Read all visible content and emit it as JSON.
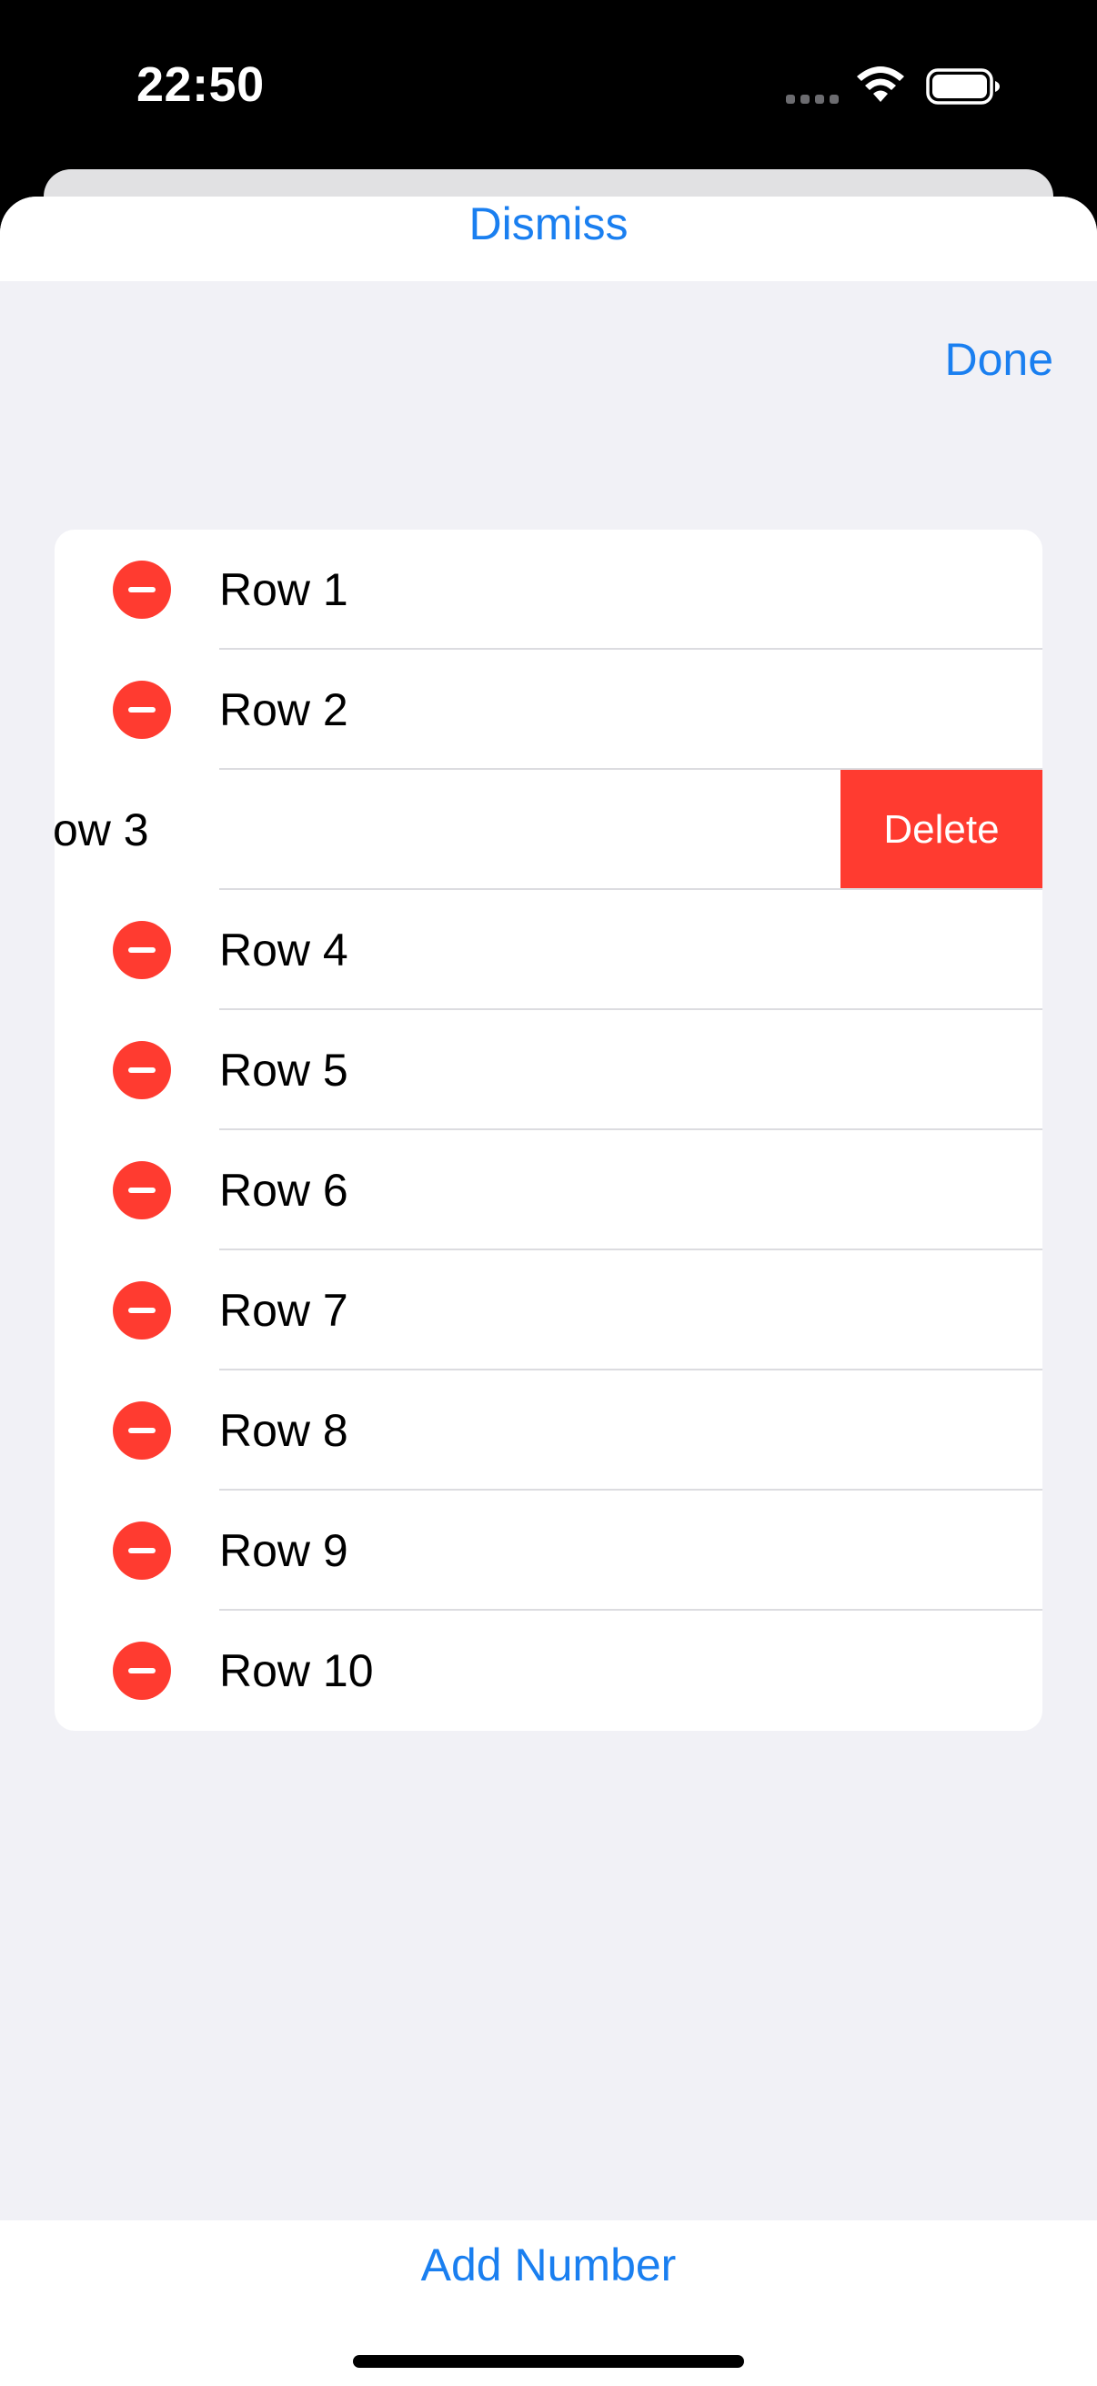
{
  "status_bar": {
    "time": "22:50",
    "icons": [
      "cellular-signal-icon",
      "wifi-icon",
      "battery-icon"
    ]
  },
  "sheet": {
    "dismiss_label": "Dismiss",
    "done_label": "Done"
  },
  "list": {
    "rows": [
      {
        "label": "Row 1"
      },
      {
        "label": "Row 2"
      },
      {
        "label": "ow 3",
        "swiped": true,
        "action_label": "Delete"
      },
      {
        "label": "Row 4"
      },
      {
        "label": "Row 5"
      },
      {
        "label": "Row 6"
      },
      {
        "label": "Row 7"
      },
      {
        "label": "Row 8"
      },
      {
        "label": "Row 9"
      },
      {
        "label": "Row 10"
      }
    ]
  },
  "toolbar": {
    "add_label": "Add Number"
  },
  "colors": {
    "accent": "#1a7ff0",
    "destructive": "#ff3b30",
    "grouped_background": "#f1f1f6"
  }
}
